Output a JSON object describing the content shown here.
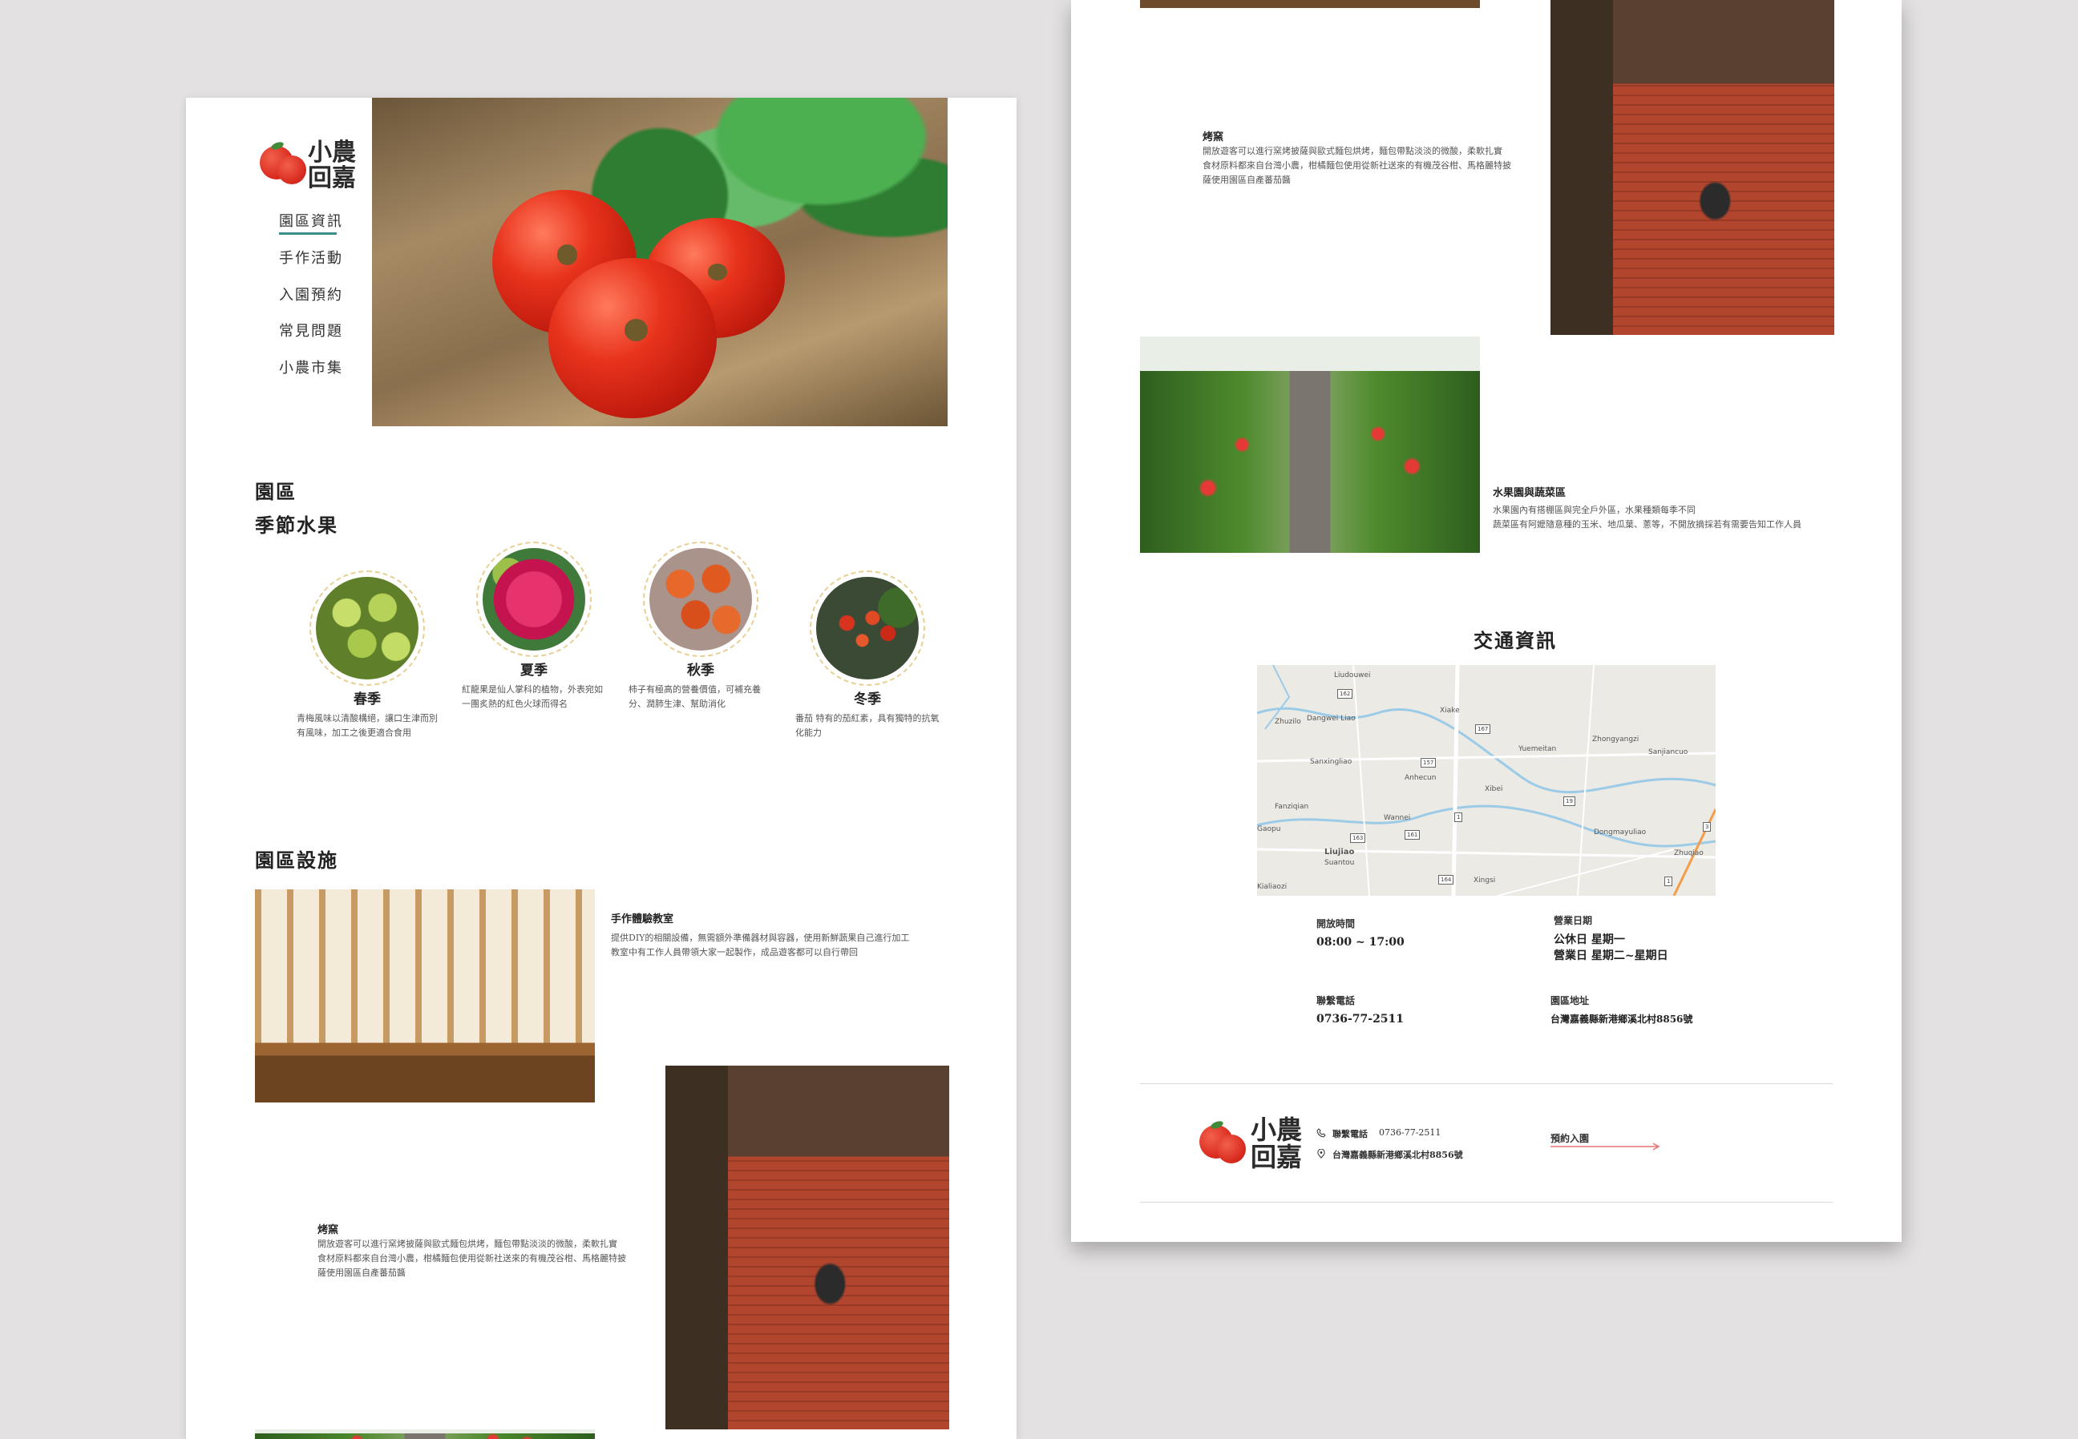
{
  "brand": {
    "line1": "小農",
    "line2": "回嘉"
  },
  "nav": {
    "items": [
      "園區資訊",
      "手作活動",
      "入園預約",
      "常見問題",
      "小農市集"
    ],
    "active_index": 0
  },
  "seasonal": {
    "title_line1": "園區",
    "title_line2": "季節水果",
    "items": [
      {
        "name": "春季",
        "desc": "青梅風味以清酸構絕，讓口生津而別有風味，加工之後更適合食用",
        "icon": "green-plum-photo"
      },
      {
        "name": "夏季",
        "desc": "紅龍果是仙人掌科的植物，外表宛如一團炙熱的紅色火球而得名",
        "icon": "dragon-fruit-photo"
      },
      {
        "name": "秋季",
        "desc": "柿子有極高的營養價值，可補充養分、潤肺生津、幫助消化",
        "icon": "persimmon-photo"
      },
      {
        "name": "冬季",
        "desc": "番茄 特有的茄紅素，具有獨特的抗氧化能力",
        "icon": "cherry-tomato-photo"
      }
    ]
  },
  "facilities": {
    "title": "園區設施",
    "workshop": {
      "title": "手作體驗教室",
      "desc_line1": "提供DIY的相關設備，無需額外準備器材與容器，使用新鮮蔬果自己進行加工",
      "desc_line2": "教室中有工作人員帶領大家一起製作，成品遊客都可以自行帶回"
    },
    "kiln": {
      "title": "烤窯",
      "desc_line1": "開放遊客可以進行窯烤披薩與歐式麵包烘烤，麵包帶點淡淡的微酸，柔軟扎實",
      "desc_line2": "食材原料都來自台灣小農，柑橘麵包使用從新社送來的有機茂谷柑、馬格麗特披",
      "desc_line3": "薩使用園區自產蕃茄醬"
    },
    "orchard": {
      "title": "水果園與蔬菜區",
      "desc_line1": "水果園內有搭棚區與完全戶外區，水果種類每季不同",
      "desc_line2": "蔬菜區有阿嬤隨意種的玉米、地瓜葉、蔥等，不開放摘採若有需要告知工作人員"
    }
  },
  "transport": {
    "title": "交通資訊",
    "map": {
      "places": [
        "Liudouwei",
        "Xiake",
        "Dangwei Liao",
        "Sanxingliao",
        "Anhecun",
        "Xibei",
        "Yuemeitan",
        "Zhongyangzi",
        "Sanjiancuo",
        "Wannei",
        "Dongmayuliao",
        "Liujiao",
        "Suantou",
        "Xingsi",
        "Kialiaozi",
        "Zhuqiao",
        "Fanziqian",
        "Zhuzilo",
        "Gaopu"
      ],
      "routes": [
        "162",
        "167",
        "157",
        "1",
        "19",
        "161",
        "163",
        "164",
        "1",
        "3"
      ]
    },
    "hours_label": "開放時間",
    "hours_value": "08:00 ~ 17:00",
    "days_label": "營業日期",
    "days_line1": "公休日 星期一",
    "days_line2": "營業日 星期二~星期日",
    "phone_label": "聯繫電話",
    "phone_value": "0736-77-2511",
    "address_label": "園區地址",
    "address_value": "台灣嘉義縣新港鄉溪北村8856號"
  },
  "footer": {
    "phone_label": "聯繫電話",
    "phone_value": "0736-77-2511",
    "address": "台灣嘉義縣新港鄉溪北村8856號",
    "cta": "預約入園"
  },
  "colors": {
    "accent_teal": "#3b8f8a",
    "tomato_red": "#d92b20",
    "cta_pink": "#e57373",
    "dashed_gold": "#e8cf93"
  }
}
